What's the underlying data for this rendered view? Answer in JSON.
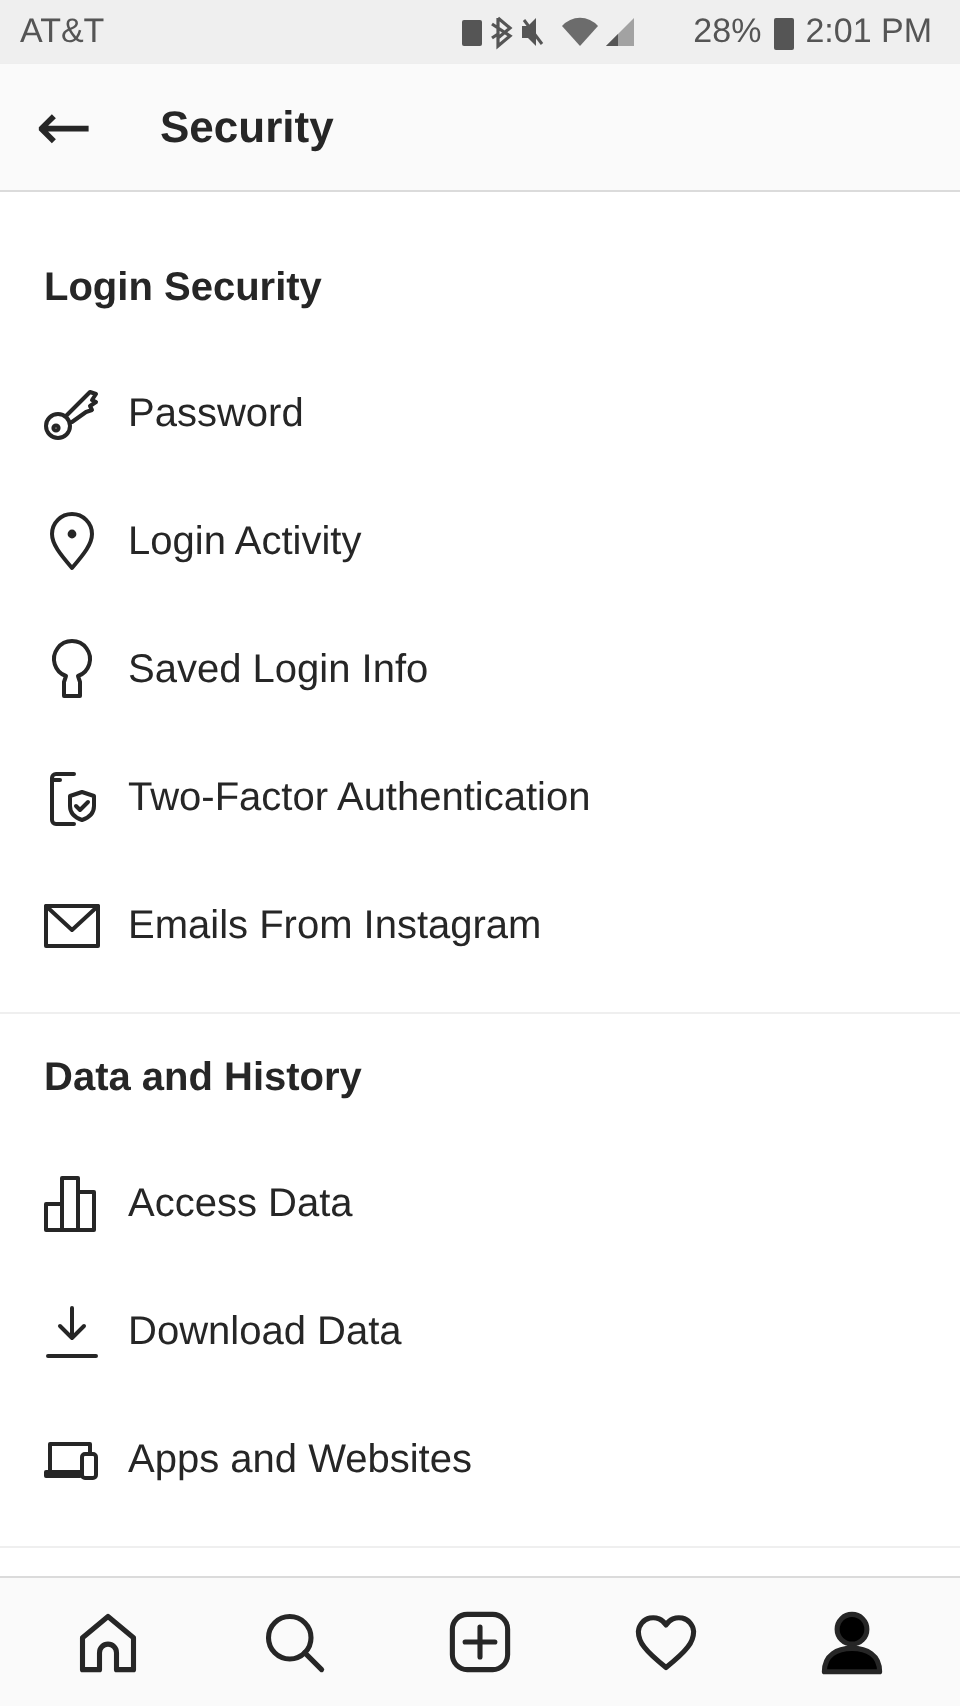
{
  "status_bar": {
    "carrier": "AT&T",
    "battery_percent": "28%",
    "time": "2:01 PM"
  },
  "header": {
    "back": "←",
    "title": "Security"
  },
  "sections": [
    {
      "title": "Login Security",
      "items": [
        {
          "kind": "key",
          "label": "Password"
        },
        {
          "kind": "pin",
          "label": "Login Activity"
        },
        {
          "kind": "keyhole",
          "label": "Saved Login Info"
        },
        {
          "kind": "phone-shield",
          "label": "Two-Factor Authentication"
        },
        {
          "kind": "mail",
          "label": "Emails From Instagram"
        }
      ]
    },
    {
      "title": "Data and History",
      "items": [
        {
          "kind": "bars",
          "label": "Access Data"
        },
        {
          "kind": "download",
          "label": "Download Data"
        },
        {
          "kind": "devices",
          "label": "Apps and Websites"
        }
      ]
    }
  ],
  "nav": [
    {
      "kind": "home",
      "selected": false
    },
    {
      "kind": "search",
      "selected": false
    },
    {
      "kind": "add",
      "selected": false
    },
    {
      "kind": "heart",
      "selected": false
    },
    {
      "kind": "profile",
      "selected": true
    }
  ]
}
